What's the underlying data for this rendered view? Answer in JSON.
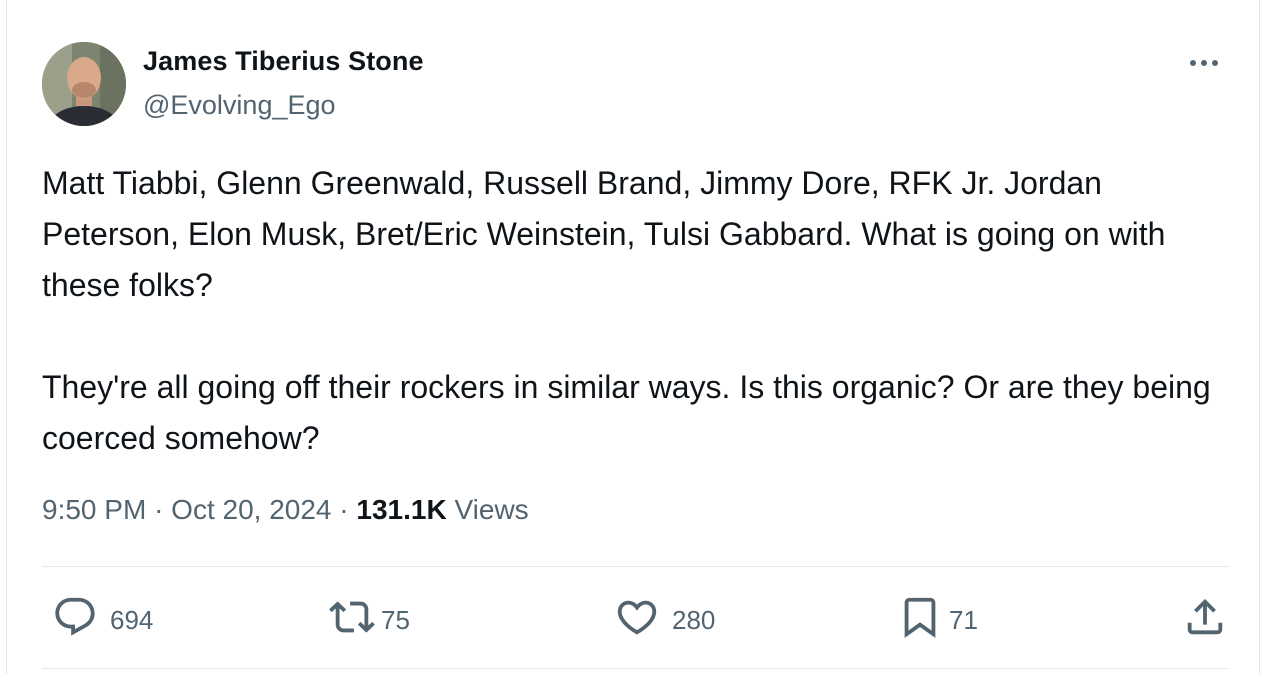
{
  "author": {
    "name": "James Tiberius Stone",
    "handle": "@Evolving_Ego"
  },
  "tweet": {
    "text": "Matt Tiabbi, Glenn Greenwald, Russell Brand, Jimmy Dore, RFK Jr. Jordan Peterson, Elon Musk, Bret/Eric Weinstein, Tulsi Gabbard. What is going on with these folks?\n\nThey're all going off their rockers in similar ways. Is this organic? Or are they being coerced somehow?",
    "time": "9:50 PM",
    "separator": "·",
    "date": "Oct 20, 2024",
    "views_count": "131.1K",
    "views_label": "Views"
  },
  "actions": {
    "replies": "694",
    "reposts": "75",
    "likes": "280",
    "bookmarks": "71"
  },
  "icons": [
    "reply-icon",
    "repost-icon",
    "like-icon",
    "bookmark-icon",
    "share-icon",
    "more-icon"
  ],
  "colors": {
    "text": "#0f1419",
    "secondary": "#536471",
    "divider": "#e6e6e6"
  }
}
